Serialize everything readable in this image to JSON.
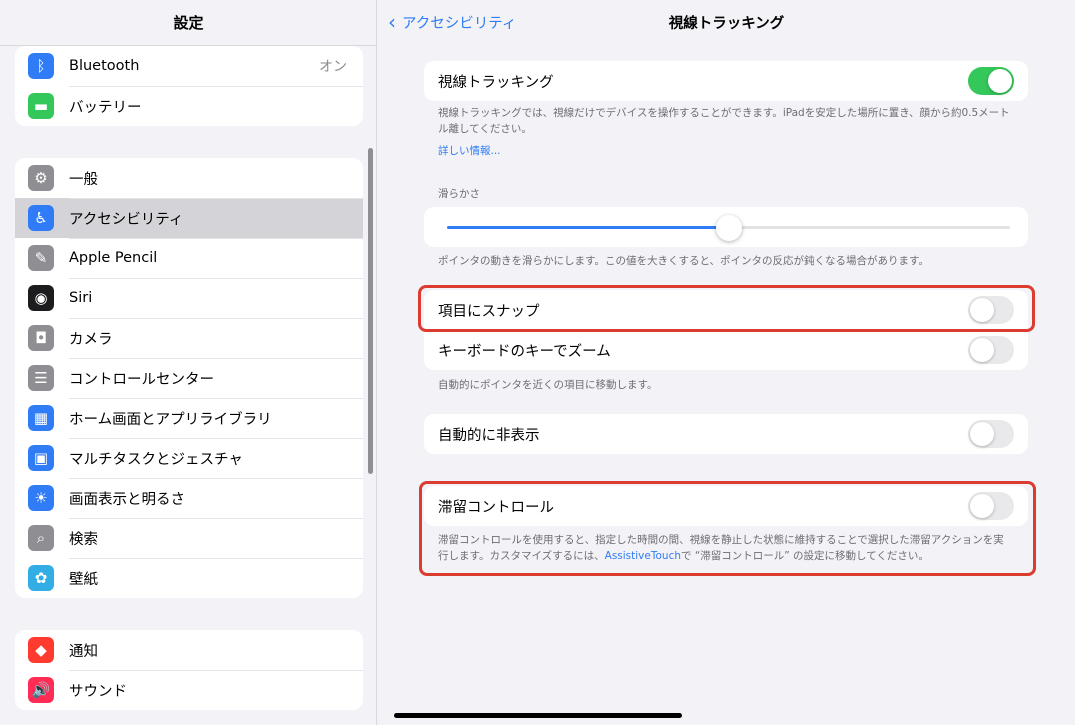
{
  "sidebar": {
    "title": "設定",
    "group1": [
      {
        "label": "Bluetooth",
        "value": "オン",
        "icon": "bluetooth-icon",
        "color": "#2f7cf6",
        "glyph": "ᛒ"
      },
      {
        "label": "バッテリー",
        "icon": "battery-icon",
        "color": "#34c759",
        "glyph": "▬"
      }
    ],
    "group2": [
      {
        "label": "一般",
        "icon": "gear-icon",
        "color": "#8e8e93",
        "glyph": "⚙"
      },
      {
        "label": "アクセシビリティ",
        "icon": "accessibility-icon",
        "color": "#2f7cf6",
        "glyph": "♿",
        "selected": true
      },
      {
        "label": "Apple Pencil",
        "icon": "pencil-icon",
        "color": "#8e8e93",
        "glyph": "✎"
      },
      {
        "label": "Siri",
        "icon": "siri-icon",
        "color": "#1c1c1e",
        "glyph": "◉"
      },
      {
        "label": "カメラ",
        "icon": "camera-icon",
        "color": "#8e8e93",
        "glyph": "◘"
      },
      {
        "label": "コントロールセンター",
        "icon": "control-center-icon",
        "color": "#8e8e93",
        "glyph": "☰"
      },
      {
        "label": "ホーム画面とアプリライブラリ",
        "icon": "home-screen-icon",
        "color": "#2f7cf6",
        "glyph": "▦"
      },
      {
        "label": "マルチタスクとジェスチャ",
        "icon": "multitasking-icon",
        "color": "#2f7cf6",
        "glyph": "▣"
      },
      {
        "label": "画面表示と明るさ",
        "icon": "brightness-icon",
        "color": "#2f7cf6",
        "glyph": "☀"
      },
      {
        "label": "検索",
        "icon": "search-icon",
        "color": "#8e8e93",
        "glyph": "⌕"
      },
      {
        "label": "壁紙",
        "icon": "wallpaper-icon",
        "color": "#32ade6",
        "glyph": "✿"
      }
    ],
    "group3": [
      {
        "label": "通知",
        "icon": "notification-icon",
        "color": "#ff3b30",
        "glyph": "◆"
      },
      {
        "label": "サウンド",
        "icon": "sound-icon",
        "color": "#ff2d55",
        "glyph": "🔊"
      }
    ]
  },
  "main": {
    "back_label": "アクセシビリティ",
    "title": "視線トラッキング",
    "eye_tracking": {
      "label": "視線トラッキング",
      "on": true
    },
    "eye_tracking_note": "視線トラッキングでは、視線だけでデバイスを操作することができます。iPadを安定した場所に置き、顔から約0.5メートル離してください。",
    "more_info": "詳しい情報...",
    "smoothing_label": "滑らかさ",
    "smoothing_value": 0.5,
    "smoothing_note": "ポインタの動きを滑らかにします。この値を大きくすると、ポインタの反応が鈍くなる場合があります。",
    "snap_label": "項目にスナップ",
    "zoom_label": "キーボードのキーでズーム",
    "snap_note": "自動的にポインタを近くの項目に移動します。",
    "autohide_label": "自動的に非表示",
    "dwell_label": "滞留コントロール",
    "dwell_note_1": "滞留コントロールを使用すると、指定した時間の間、視線を静止した状態に維持することで選択した滞留アクションを実行します。カスタマイズするには、",
    "dwell_note_link": "AssistiveTouch",
    "dwell_note_2": "で “滞留コントロール” の設定に移動してください。"
  }
}
